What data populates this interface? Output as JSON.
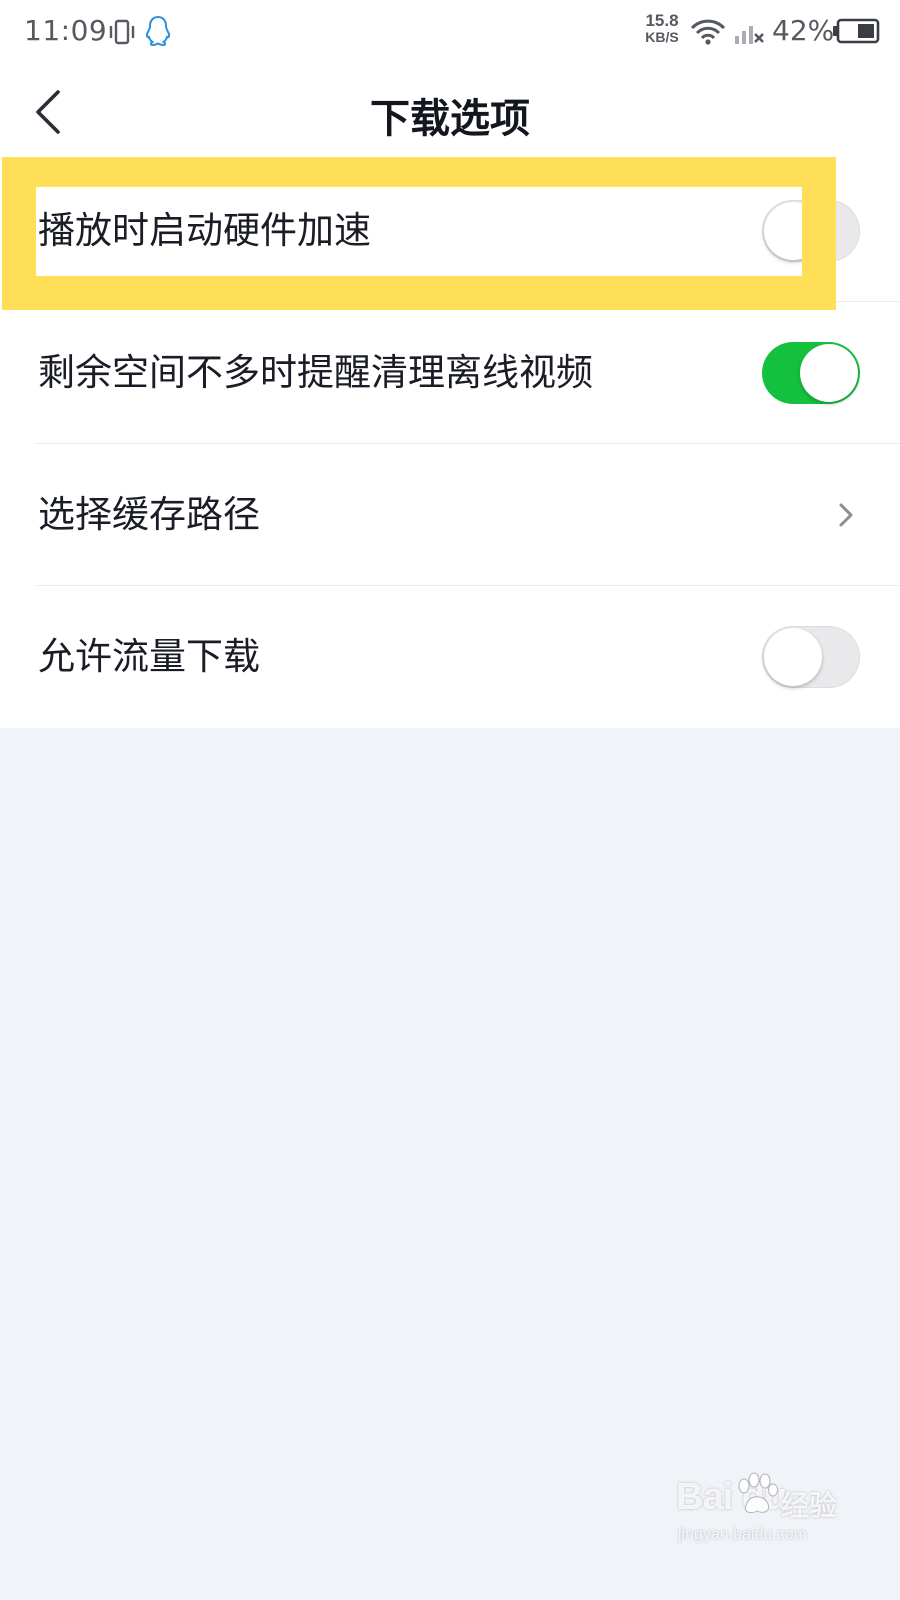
{
  "status_bar": {
    "time": "11:09",
    "net_speed_value": "15.8",
    "net_speed_unit": "KB/S",
    "battery": "42%",
    "icons": [
      "vibrate-icon",
      "qq-icon",
      "wifi-icon",
      "signal-icon",
      "battery-icon"
    ]
  },
  "header": {
    "title": "下载选项",
    "back_icon": "chevron-left-icon"
  },
  "settings": [
    {
      "label": "播放时启动硬件加速",
      "control": "toggle",
      "on": false
    },
    {
      "label": "剩余空间不多时提醒清理离线视频",
      "control": "toggle",
      "on": true
    },
    {
      "label": "选择缓存路径",
      "control": "chevron",
      "icon": "chevron-right-icon"
    },
    {
      "label": "允许流量下载",
      "control": "toggle",
      "on": false
    }
  ],
  "colors": {
    "accent_green": "#14c13f",
    "highlight_yellow": "#ffdf58",
    "page_background": "#f0f3f8"
  },
  "watermark": {
    "logo": "Bai du",
    "cn": "经验",
    "url": "jingyan.baidu.com"
  }
}
